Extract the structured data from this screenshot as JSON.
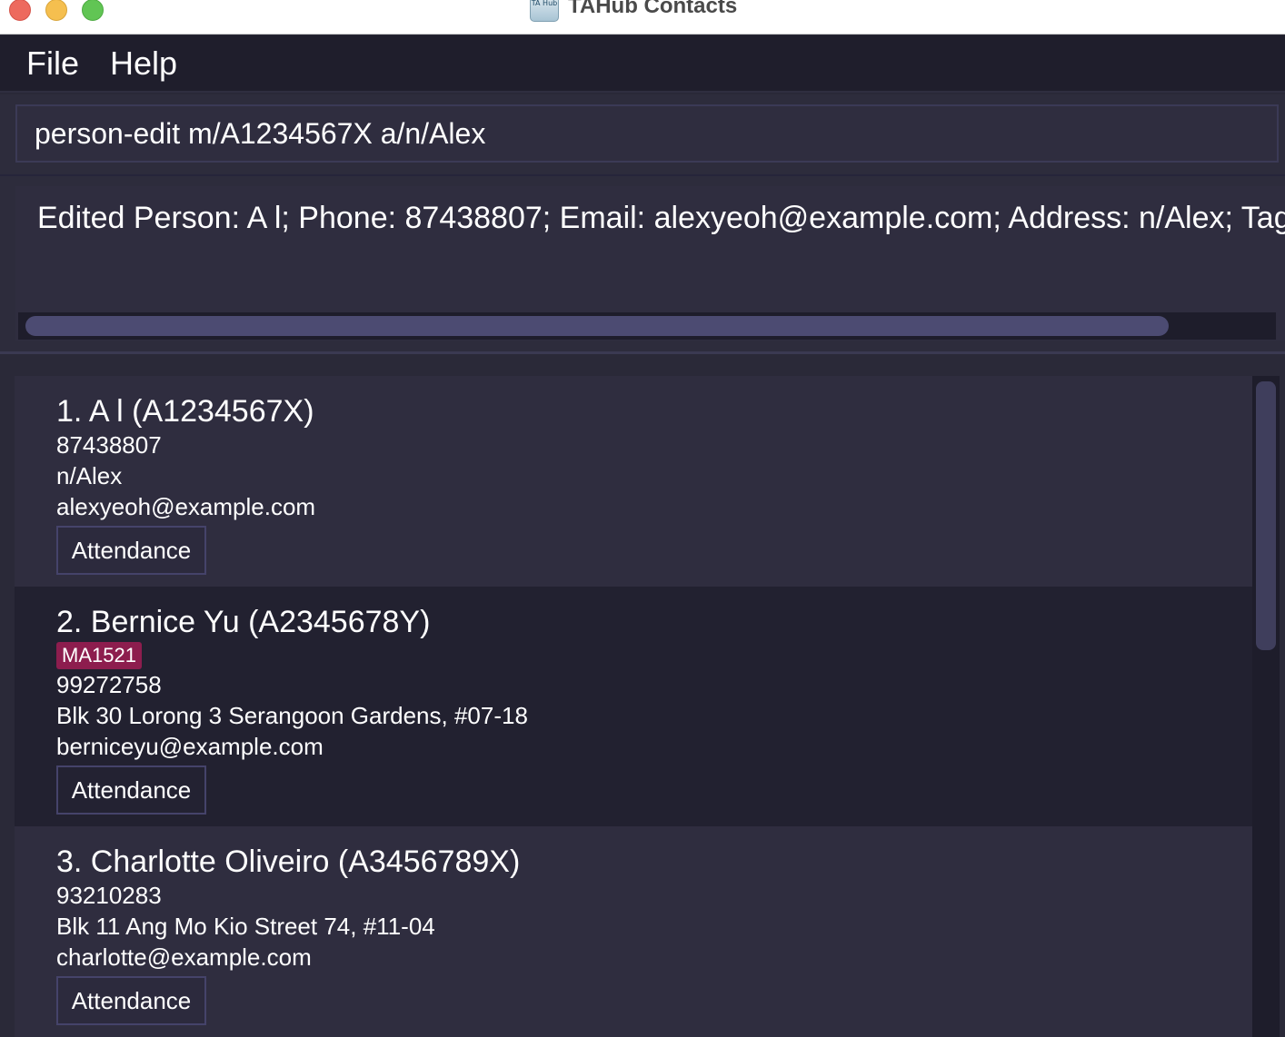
{
  "window": {
    "title": "TAHub Contacts",
    "icon_text": "TA Hub"
  },
  "menu": {
    "file": "File",
    "help": "Help"
  },
  "command": {
    "value": "person-edit m/A1234567X a/n/Alex"
  },
  "result": {
    "text": "Edited Person: A l; Phone: 87438807; Email: alexyeoh@example.com; Address: n/Alex; Tags: [f"
  },
  "persons": [
    {
      "title": "1.  A l (A1234567X)",
      "tags": [],
      "phone": "87438807",
      "address": "n/Alex",
      "email": "alexyeoh@example.com",
      "button": "Attendance"
    },
    {
      "title": "2.  Bernice Yu (A2345678Y)",
      "tags": [
        "MA1521"
      ],
      "phone": "99272758",
      "address": "Blk 30 Lorong 3 Serangoon Gardens, #07-18",
      "email": "berniceyu@example.com",
      "button": "Attendance"
    },
    {
      "title": "3.  Charlotte Oliveiro (A3456789X)",
      "tags": [],
      "phone": "93210283",
      "address": "Blk 11 Ang Mo Kio Street 74, #11-04",
      "email": "charlotte@example.com",
      "button": "Attendance"
    }
  ],
  "colors": {
    "tag": "#8d1d4e",
    "background": "#2a2938",
    "card_odd": "#2f2d3f",
    "card_even": "#222130"
  }
}
